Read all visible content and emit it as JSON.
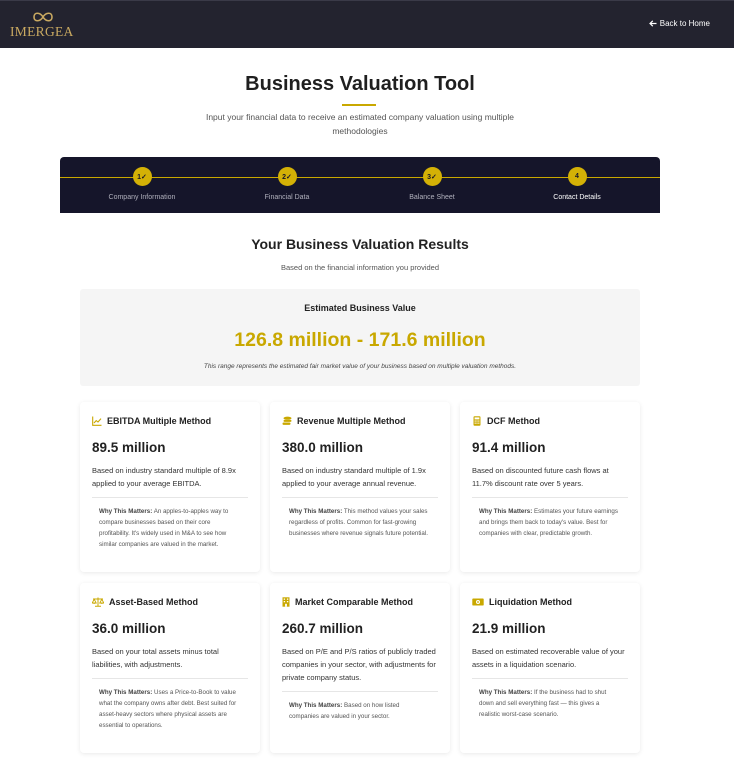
{
  "header": {
    "logo_text": "IMERGEA",
    "back_link": "Back to Home"
  },
  "page": {
    "title": "Business Valuation Tool",
    "subtitle": "Input your financial data to receive an estimated company valuation using multiple methodologies"
  },
  "stepper": {
    "steps": [
      {
        "number": "1✓",
        "label": "Company Information",
        "state": "completed"
      },
      {
        "number": "2✓",
        "label": "Financial Data",
        "state": "completed"
      },
      {
        "number": "3✓",
        "label": "Balance Sheet",
        "state": "completed"
      },
      {
        "number": "4",
        "label": "Contact Details",
        "state": "active"
      }
    ]
  },
  "results": {
    "title": "Your Business Valuation Results",
    "subtitle": "Based on the financial information you provided",
    "estimate_label": "Estimated Business Value",
    "estimate_value": "126.8 million - 171.6 million",
    "estimate_note": "This range represents the estimated fair market value of your business based on multiple valuation methods."
  },
  "why_label": "Why This Matters:",
  "methods": [
    {
      "icon": "chart-line-icon",
      "title": "EBITDA Multiple Method",
      "value": "89.5 million",
      "description": "Based on industry standard multiple of 8.9x applied to your average EBITDA.",
      "why": "An apples-to-apples way to compare businesses based on their core profitability. It's widely used in M&A to see how similar companies are valued in the market."
    },
    {
      "icon": "coins-icon",
      "title": "Revenue Multiple Method",
      "value": "380.0 million",
      "description": "Based on industry standard multiple of 1.9x applied to your average annual revenue.",
      "why": "This method values your sales regardless of profits. Common for fast-growing businesses where revenue signals future potential."
    },
    {
      "icon": "calculator-icon",
      "title": "DCF Method",
      "value": "91.4 million",
      "description": "Based on discounted future cash flows at 11.7% discount rate over 5 years.",
      "why": "Estimates your future earnings and brings them back to today's value. Best for companies with clear, predictable growth."
    },
    {
      "icon": "balance-scale-icon",
      "title": "Asset-Based Method",
      "value": "36.0 million",
      "description": "Based on your total assets minus total liabilities, with adjustments.",
      "why": "Uses a Price-to-Book to value what the company owns after debt. Best suited for asset-heavy sectors where physical assets are essential to operations."
    },
    {
      "icon": "building-icon",
      "title": "Market Comparable Method",
      "value": "260.7 million",
      "description": "Based on P/E and P/S ratios of publicly traded companies in your sector, with adjustments for private company status.",
      "why": "Based on how listed companies are valued in your sector."
    },
    {
      "icon": "money-bill-icon",
      "title": "Liquidation Method",
      "value": "21.9 million",
      "description": "Based on estimated recoverable value of your assets in a liquidation scenario.",
      "why": "If the business had to shut down and sell everything fast — this gives a realistic worst-case scenario."
    }
  ],
  "colors": {
    "header_bg": "#23232f",
    "stepper_bg": "#15152a",
    "accent_gold": "#c9a800",
    "estimate_bg": "#f5f5f5"
  }
}
